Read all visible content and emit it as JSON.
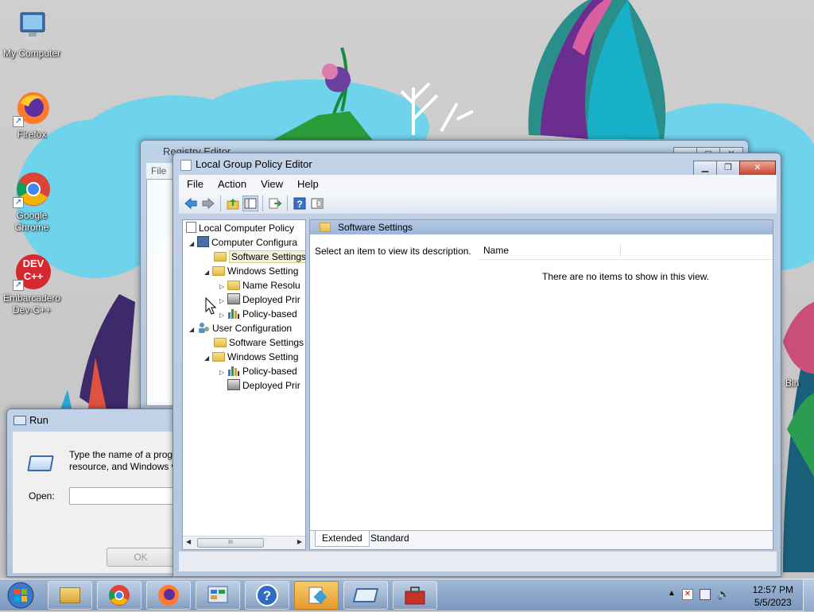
{
  "desktop": {
    "icons": [
      {
        "label": "My Computer",
        "icon": "my-computer-icon"
      },
      {
        "label": "Firefox",
        "icon": "firefox-icon"
      },
      {
        "label": "Google Chrome",
        "icon": "chrome-icon"
      },
      {
        "label": "Embarcadero Dev-C++",
        "icon": "devcpp-icon",
        "badge": "DEV C++"
      }
    ],
    "recycle_bin_label_fragment": "Bin"
  },
  "registry_window": {
    "title_fragment": "Registry Editor",
    "menu_fragment": "File"
  },
  "gpe_window": {
    "title": "Local Group Policy Editor",
    "menu": [
      "File",
      "Action",
      "View",
      "Help"
    ],
    "toolbar": [
      "back-icon",
      "forward-icon",
      "up-folder-icon",
      "show-hide-tree-icon",
      "export-list-icon",
      "help-icon",
      "properties-view-icon"
    ],
    "tree": {
      "root": "Local Computer Policy",
      "items": [
        {
          "label": "Computer Configura",
          "icon": "computer-config-icon",
          "expander": "◢",
          "level": 1
        },
        {
          "label": "Software Settings",
          "icon": "folder-icon",
          "expander": "",
          "level": 2,
          "selected": true
        },
        {
          "label": "Windows Setting",
          "icon": "folder-icon",
          "expander": "◢",
          "level": 2
        },
        {
          "label": "Name Resolu",
          "icon": "folder-icon",
          "expander": "▷",
          "level": 3
        },
        {
          "label": "Deployed Prir",
          "icon": "printer-icon",
          "expander": "▷",
          "level": 3
        },
        {
          "label": "Policy-based",
          "icon": "chart-icon",
          "expander": "▷",
          "level": 3
        },
        {
          "label": "User Configuration",
          "icon": "user-config-icon",
          "expander": "◢",
          "level": 1
        },
        {
          "label": "Software Settings",
          "icon": "folder-icon",
          "expander": "",
          "level": 2
        },
        {
          "label": "Windows Setting",
          "icon": "folder-icon",
          "expander": "◢",
          "level": 2
        },
        {
          "label": "Policy-based",
          "icon": "chart-icon",
          "expander": "▷",
          "level": 3
        },
        {
          "label": "Deployed Prir",
          "icon": "printer-icon",
          "expander": "",
          "level": 3
        }
      ],
      "scroll_thumb_glyph": "III"
    },
    "details": {
      "header": "Software Settings",
      "description": "Select an item to view its description.",
      "column_name": "Name",
      "empty_message": "There are no items to show in this view.",
      "tabs": [
        "Extended",
        "Standard"
      ],
      "active_tab": "Extended"
    }
  },
  "run_dialog": {
    "title": "Run",
    "text_line1": "Type the name of a progra",
    "text_line2": "resource, and Windows wi",
    "open_label": "Open:",
    "open_value": "",
    "ok_label": "OK"
  },
  "taskbar": {
    "buttons": [
      "start-orb-icon",
      "explorer-icon",
      "chrome-icon",
      "firefox-icon",
      "control-panel-icon",
      "help-icon",
      "group-policy-icon",
      "run-icon",
      "toolbox-icon"
    ],
    "tray_icons": [
      "show-hidden-icon",
      "action-center-icon",
      "network-icon",
      "volume-icon"
    ],
    "time": "12:57 PM",
    "date": "5/5/2023"
  },
  "colors": {
    "accent_window": "#b9cce3",
    "selection": "#f3efd8",
    "cloud": "#6fd3ec"
  }
}
